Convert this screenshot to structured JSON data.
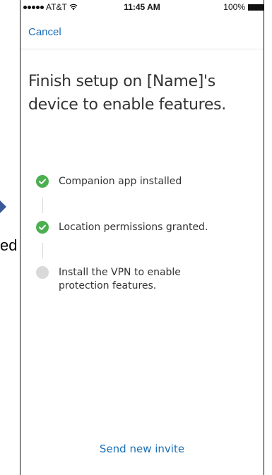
{
  "fragments": {
    "left_text": "ed"
  },
  "status_bar": {
    "carrier": "AT&T",
    "time": "11:45 AM",
    "battery": "100%"
  },
  "header": {
    "cancel_label": "Cancel"
  },
  "main": {
    "title": "Finish setup on [Name]'s device to enable features.",
    "steps": [
      {
        "label": "Companion app installed",
        "status": "complete"
      },
      {
        "label": "Location permissions granted.",
        "status": "complete"
      },
      {
        "label": "Install the VPN to enable protection features.",
        "status": "pending"
      }
    ]
  },
  "footer": {
    "send_invite_label": "Send new invite"
  },
  "colors": {
    "link": "#1a6fb5",
    "complete": "#4caf50",
    "pending": "#d9d9d9"
  }
}
